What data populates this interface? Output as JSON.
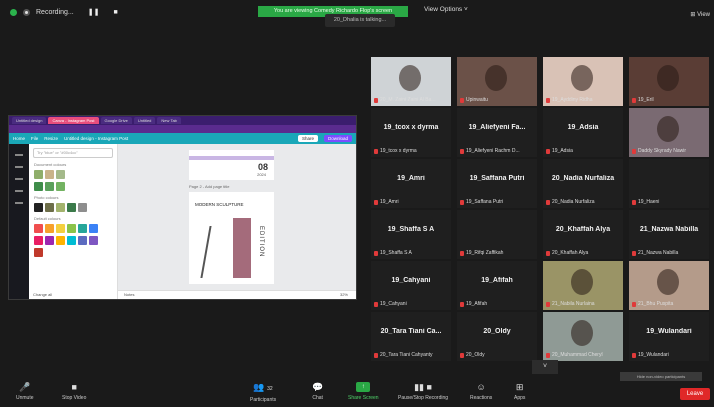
{
  "topbar": {
    "recording_label": "Recording...",
    "pause_icon": "pause-icon",
    "stop_icon": "stop-icon",
    "banner_text": "You are viewing Comedy Richardo Flop's screen",
    "talking_text": "20_Dhalia is talking...",
    "view_options": "View Options ˅",
    "view_label": "⊞ View"
  },
  "share": {
    "tabs": [
      "Untitled design",
      "Canva - Instagram Post",
      "Google Drive",
      "Untitled",
      "New Tab"
    ],
    "canva_menu": [
      "Home",
      "File",
      "Resize",
      "Untitled design - Instagram Post",
      "Share",
      "Download"
    ],
    "share_label": "Share",
    "download_label": "Download",
    "search_placeholder": "Try \"blue\" or \"#00c4cc\"",
    "section_labels": [
      "Document colours",
      "Photo colours",
      "Default colours"
    ],
    "swatch_rows": [
      [
        "#8fae6a",
        "#c9b38a",
        "#a4b98a"
      ],
      [
        "#3f8d4a",
        "#5aa05b",
        "#73b362"
      ],
      [
        "#222222",
        "#6d6e49",
        "#a3b36d",
        "#3b7a4a",
        "#8e8e8e"
      ],
      [
        "#f04e4e",
        "#f7a12b",
        "#f4d03f",
        "#8bc34a",
        "#26a69a",
        "#3b82f6"
      ],
      [
        "#e91e63",
        "#9c27b0",
        "#ffb300",
        "#00bcd4",
        "#5c6bc0",
        "#7e57c2"
      ],
      [
        "#c0392b"
      ]
    ],
    "panel_footer": "Change all",
    "page1_number": "08",
    "page1_year": "2024",
    "page2_label": "Page 2 - Add page title",
    "card_title": "MODERN SCULPTURE",
    "card_vertical": "EDITION",
    "canvas_footer": "Notes",
    "zoom": "32%"
  },
  "participants": [
    {
      "name": "",
      "label": "20_M. Zaini Zaini Al Ba...",
      "style": "photo-a"
    },
    {
      "name": "",
      "label": "Upinwaitu",
      "style": "photo-b"
    },
    {
      "name": "",
      "label": "19_Ayddiny Ridha",
      "style": "photo-c"
    },
    {
      "name": "",
      "label": "19_Eril",
      "style": "photo-d"
    },
    {
      "name": "19_tcox x dyrma",
      "label": "19_tcox x dyrma",
      "style": "dark"
    },
    {
      "name": "19_Aliefyeni Fa...",
      "label": "19_Aliefyeni Rachm D...",
      "style": "dark"
    },
    {
      "name": "19_Adsia",
      "label": "19_Adsia",
      "style": "dark"
    },
    {
      "name": "",
      "label": "Daddy Skyrady Nawir",
      "style": "photo-e"
    },
    {
      "name": "19_Amri",
      "label": "19_Amri",
      "style": "dark"
    },
    {
      "name": "19_Saffana Putri",
      "label": "19_Saffana Putri",
      "style": "dark"
    },
    {
      "name": "20_Nadia Nurfaliza",
      "label": "20_Nadia Nurfaliza",
      "style": "dark"
    },
    {
      "name": "",
      "label": "19_Haeni",
      "style": "dark"
    },
    {
      "name": "19_Shaffa S A",
      "label": "19_Shaffa S A",
      "style": "dark"
    },
    {
      "name": "",
      "label": "19_Rifqi Zaffikah",
      "style": "dark"
    },
    {
      "name": "20_Khaffah Alya",
      "label": "20_Khaffah Alya",
      "style": "dark"
    },
    {
      "name": "21_Nazwa Nabilla",
      "label": "21_Nazwa Nabilla",
      "style": "dark"
    },
    {
      "name": "19_Cahyani",
      "label": "19_Cahyani",
      "style": "dark"
    },
    {
      "name": "19_Afifah",
      "label": "19_Afifah",
      "style": "dark"
    },
    {
      "name": "",
      "label": "21_Nabila Nurlaina",
      "style": "photo-f"
    },
    {
      "name": "",
      "label": "21_Bhu Puspita",
      "style": "photo-g"
    },
    {
      "name": "20_Tara Tiani Ca...",
      "label": "20_Tara Tiani Cahyanty",
      "style": "dark"
    },
    {
      "name": "20_Oldy",
      "label": "20_Oldy",
      "style": "dark"
    },
    {
      "name": "",
      "label": "20_Muhammad Cheryl",
      "style": "photo-h"
    },
    {
      "name": "19_Wulandari",
      "label": "19_Wulandari",
      "style": "dark"
    }
  ],
  "grid_more": "˅",
  "pip_label": "Hide non-video participants",
  "toolbar": {
    "unmute": "Unmute",
    "stop_video": "Stop Video",
    "participants": "Participants",
    "participants_count": "32",
    "chat": "Chat",
    "share_screen": "Share Screen",
    "pause_recording": "Pause/Stop Recording",
    "reactions": "Reactions",
    "apps": "Apps",
    "end": "Leave"
  },
  "colors": {
    "accent_green": "#2aa845",
    "end_red": "#e02828",
    "canva_teal": "#1aa7b8",
    "chrome_purple": "#3b1d6e"
  }
}
